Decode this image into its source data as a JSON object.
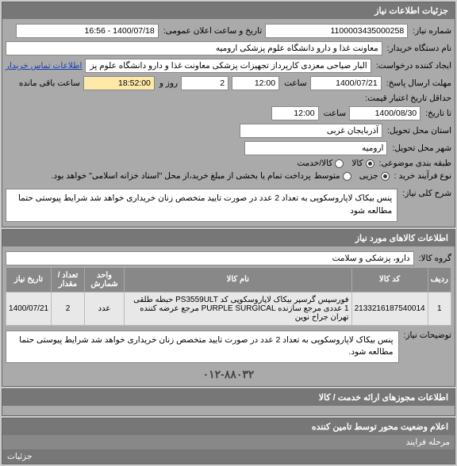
{
  "panel_main_title": "جزئیات اطلاعات نیاز",
  "labels": {
    "need_no": "شماره نیاز:",
    "announce_datetime": "تاریخ و ساعت اعلان عمومی:",
    "buyer_org": "نام دستگاه خریدار:",
    "requester": "ایجاد کننده درخواست:",
    "contact_link": "اطلاعات تماس خریدار",
    "deadline_credit": "حداقل تاریخ اعتبار قیمت:",
    "time_label": "ساعت",
    "day_and": "روز و",
    "time_remaining": "ساعت باقی مانده",
    "up_to": "تا تاریخ:",
    "send_deadline": "مهلت ارسال پاسخ:",
    "province": "استان محل تحویل:",
    "city": "شهر محل تحویل:",
    "category": "طبقه بندی موضوعی:",
    "process_type": "نوع فرآیند خرید :",
    "process_note": "پرداخت تمام یا بخشی از مبلغ خرید،از محل \"اسناد خزانه اسلامی\" خواهد بود.",
    "need_title": "شرح کلی نیاز:"
  },
  "values": {
    "need_no": "1100003435000258",
    "announce_datetime": "1400/07/18 - 16:56",
    "buyer_org": "معاونت غذا و دارو دانشگاه علوم پزشکی ارومیه",
    "requester": "البار صیاحی معزدی کارپرداز تجهیزات پزشکی معاونت غذا و دارو دانشگاه علوم پز",
    "deadline_date": "1400/07/21",
    "deadline_time": "12:00",
    "days_left": "2",
    "time_left": "18:52:00",
    "upto_date": "1400/08/30",
    "upto_time": "12:00",
    "province": "آذربایجان غربی",
    "city": "ارومیه",
    "need_title_text": "پنس بیکاک لاپاروسکوپی به تعداد 2 عدد در صورت تایید متخصص زنان خریداری خواهد شد شرایط پیوستی حتما مطالعه شود"
  },
  "category_options": [
    {
      "label": "کالا",
      "selected": true
    },
    {
      "label": "کالا/خدمت",
      "selected": false
    }
  ],
  "process_options": [
    {
      "label": "جزیی",
      "selected": true
    },
    {
      "label": "متوسط",
      "selected": false
    }
  ],
  "goods_panel": {
    "title": "اطلاعات کالاهای مورد نیاز",
    "group_label": "گروه کالا:",
    "group_value": "دارو، پزشکی و سلامت",
    "columns": [
      "ردیف",
      "کد کالا",
      "نام کالا",
      "واحد شمارش",
      "تعداد / مقدار",
      "تاریخ نیاز"
    ],
    "rows": [
      {
        "idx": "1",
        "code": "2133216187540014",
        "name": "فورسپس گرسپر بیکاک لاپاروسکوپی کد PS3559ULT حبطه طلقی 1 عددی مرجع سازنده PURPLE SURGICAL مرجع عرضه کننده تهران جراح نوین",
        "unit": "عدد",
        "qty": "2",
        "date": "1400/07/21"
      }
    ],
    "need_notes_label": "توضیحات نیاز:",
    "need_notes_value": "پنس بیکاک لاپاروسکوپی به تعداد 2 عدد در صورت تایید متخصص زنان خریداری خواهد شد شرایط پیوستی حتما مطالعه شود.",
    "phone": "۰۱۲-۸۸۰۳۲"
  },
  "license_panel_title": "اطلاعات مجوزهای ارائه خدمت / کالا",
  "status_panel_title": "اعلام وضعیت محور توسط تامین کننده",
  "status_panel_sub": "مرحله فرایند",
  "status_footer": "جزئیات"
}
